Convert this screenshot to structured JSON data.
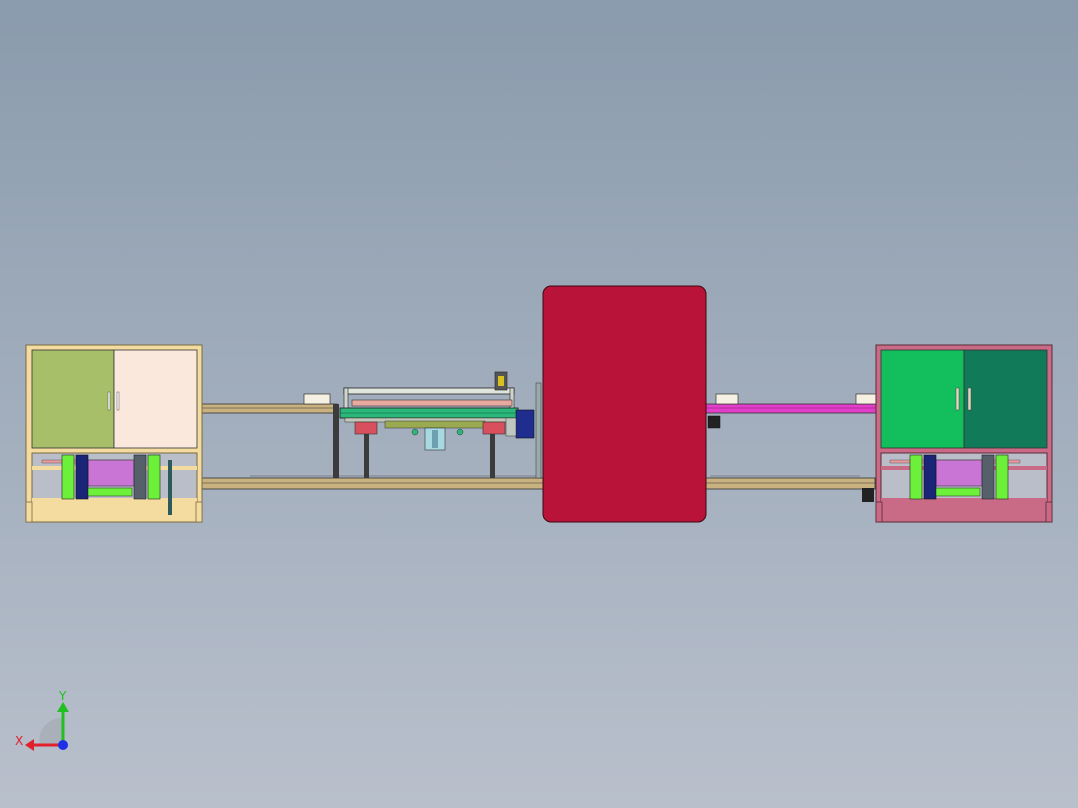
{
  "viewport": {
    "background_top": "#8a9bad",
    "background_bottom": "#b9c0cc"
  },
  "colors": {
    "cabinet_left_frame": "#f4dca0",
    "cabinet_left_door_a": "#a7bf68",
    "cabinet_left_door_b": "#fbe8dc",
    "cabinet_right_frame": "#c96b86",
    "cabinet_right_door_a": "#12bf5c",
    "cabinet_right_door_b": "#117a58",
    "center_block": "#b9133a",
    "rail_tan": "#c9b27f",
    "rail_pink": "#e33ec9",
    "gantry_green": "#2bb77a",
    "gantry_red": "#d8505e",
    "motor_blue": "#1f2d8f",
    "leg_green": "#6cf03a",
    "leg_navy": "#1b2577",
    "tray_violet": "#c975d6",
    "axis_y": "#1fc01f",
    "axis_x": "#e0202b",
    "axis_z": "#1e2fe6"
  },
  "triad": {
    "x_label": "X",
    "y_label": "Y"
  }
}
